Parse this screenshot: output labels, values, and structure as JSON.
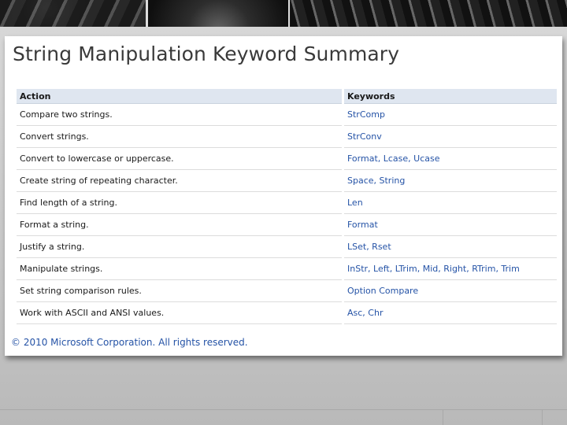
{
  "title": "String Manipulation Keyword Summary",
  "table": {
    "headers": {
      "action": "Action",
      "keywords": "Keywords"
    },
    "rows": [
      {
        "action": "Compare two strings.",
        "keywords": "StrComp"
      },
      {
        "action": "Convert strings.",
        "keywords": "StrConv"
      },
      {
        "action": "Convert to lowercase or uppercase.",
        "keywords": "Format, Lcase, Ucase"
      },
      {
        "action": "Create string of repeating character.",
        "keywords": "Space, String"
      },
      {
        "action": "Find length of a string.",
        "keywords": "Len"
      },
      {
        "action": "Format a string.",
        "keywords": "Format"
      },
      {
        "action": "Justify a string.",
        "keywords": "LSet, Rset"
      },
      {
        "action": "Manipulate strings.",
        "keywords": "InStr, Left, LTrim, Mid, Right, RTrim, Trim"
      },
      {
        "action": "Set string comparison rules.",
        "keywords": "Option Compare"
      },
      {
        "action": "Work with ASCII and ANSI values.",
        "keywords": "Asc, Chr"
      }
    ]
  },
  "copyright": "© 2010 Microsoft Corporation. All rights reserved.",
  "colors": {
    "link": "#2553a6",
    "header_bg": "#dfe6f0",
    "text": "#1a1a1a"
  }
}
